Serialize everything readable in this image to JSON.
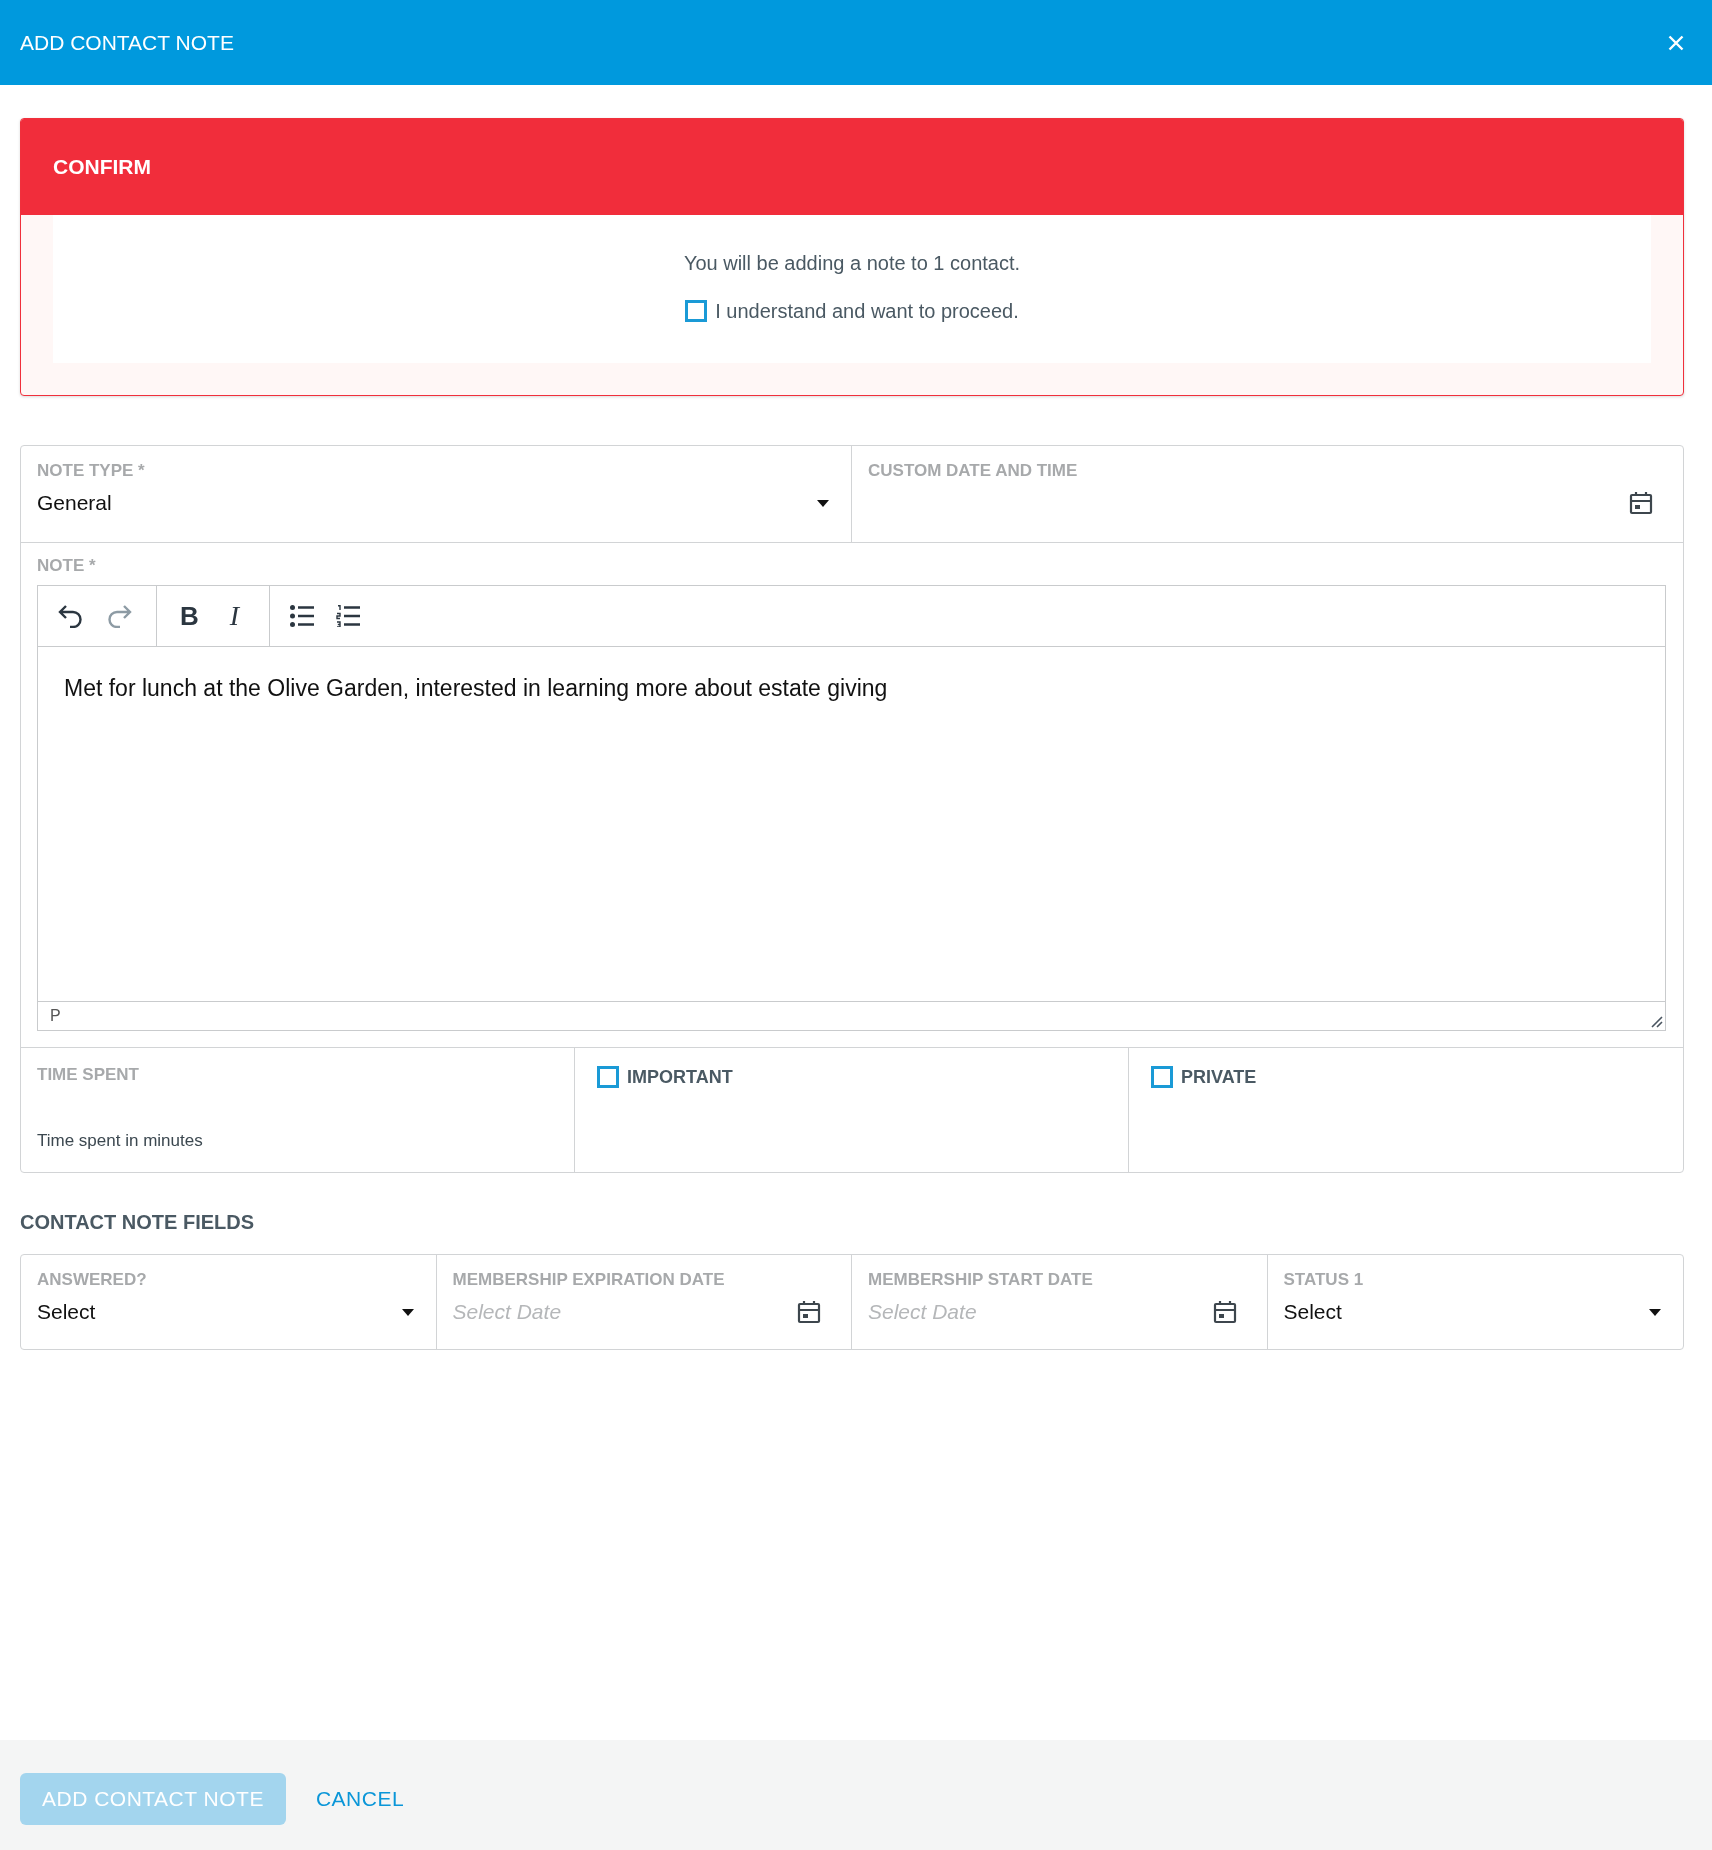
{
  "window": {
    "title": "ADD CONTACT NOTE"
  },
  "confirm": {
    "title": "CONFIRM",
    "message": "You will be adding a note to 1 contact.",
    "checkbox": {
      "label": "I understand and want to proceed.",
      "checked": false
    }
  },
  "form": {
    "fields": [
      {
        "kind": "select",
        "label": "NOTE TYPE *",
        "value": "General"
      },
      {
        "kind": "date",
        "label": "CUSTOM DATE AND TIME"
      }
    ],
    "note": {
      "label": "NOTE *",
      "toolbar_groups": [
        [
          {
            "kind": "undo",
            "disabled": false
          },
          {
            "kind": "redo",
            "disabled": true
          }
        ],
        [
          {
            "kind": "bold",
            "glyph": "B",
            "disabled": false
          },
          {
            "kind": "italic",
            "glyph": "I",
            "disabled": false
          }
        ],
        [
          {
            "kind": "bullet_list",
            "disabled": false
          },
          {
            "kind": "numbered_list",
            "disabled": false
          }
        ]
      ],
      "content": "Met for lunch at the Olive Garden, interested in learning more about estate giving",
      "element_path": "P"
    },
    "options": [
      {
        "kind": "time",
        "label": "TIME SPENT",
        "help": "Time spent in minutes"
      },
      {
        "kind": "checkbox",
        "label": "IMPORTANT",
        "checked": false
      },
      {
        "kind": "checkbox",
        "label": "PRIVATE",
        "checked": false
      }
    ]
  },
  "contact_note_fields": {
    "title": "CONTACT NOTE FIELDS",
    "fields": [
      {
        "kind": "select",
        "label": "ANSWERED?",
        "value": "Select"
      },
      {
        "kind": "date",
        "label": "MEMBERSHIP EXPIRATION DATE",
        "placeholder": "Select Date"
      },
      {
        "kind": "date",
        "label": "MEMBERSHIP START DATE",
        "placeholder": "Select Date"
      },
      {
        "kind": "select",
        "label": "STATUS 1",
        "value": "Select"
      }
    ]
  },
  "footer": {
    "buttons": [
      {
        "kind": "primary",
        "label": "ADD CONTACT NOTE",
        "disabled": true
      },
      {
        "kind": "link",
        "label": "CANCEL"
      }
    ]
  }
}
